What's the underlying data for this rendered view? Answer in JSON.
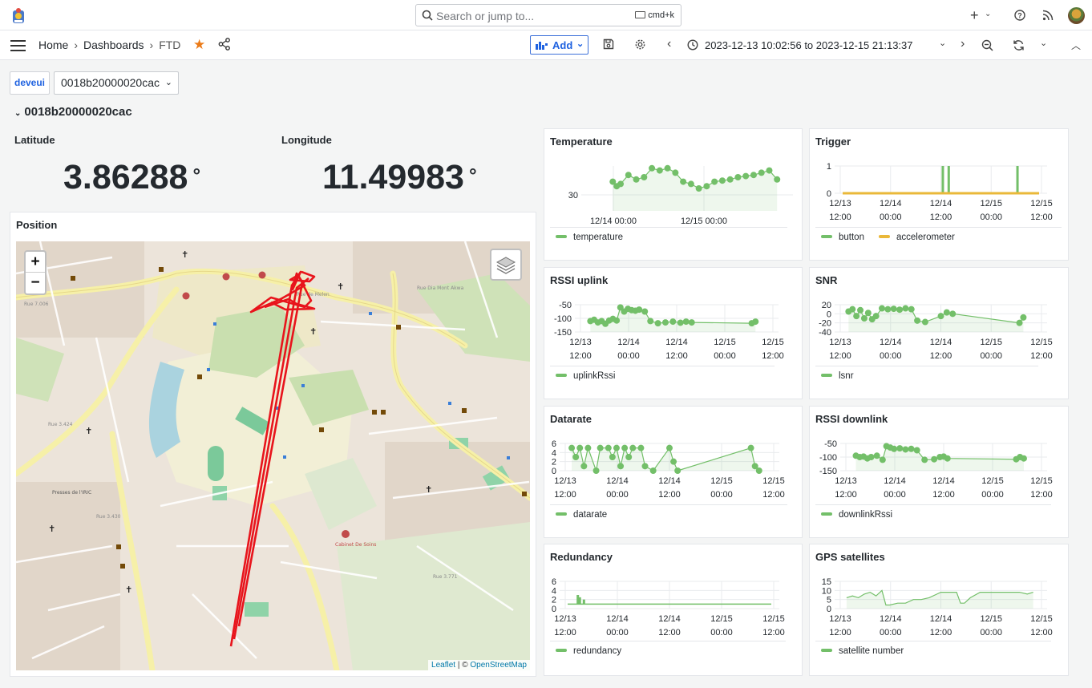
{
  "header": {
    "search_placeholder": "Search or jump to...",
    "search_shortcut": "cmd+k"
  },
  "nav": {
    "breadcrumb": [
      "Home",
      "Dashboards",
      "FTD"
    ],
    "add_label": "Add",
    "time_range": "2023-12-13 10:02:56 to 2023-12-15 21:13:37"
  },
  "variables": {
    "label": "deveui",
    "value": "0018b20000020cac"
  },
  "row": {
    "title": "0018b20000020cac"
  },
  "stats": [
    {
      "title": "Latitude",
      "value": "3.86288",
      "unit": "°"
    },
    {
      "title": "Longitude",
      "value": "11.49983",
      "unit": "°"
    }
  ],
  "map": {
    "title": "Position",
    "zoom_in": "+",
    "zoom_out": "−",
    "attribution_leaflet": "Leaflet",
    "attribution_sep": " | © ",
    "attribution_osm": "OpenStreetMap",
    "track_color": "#e8141c"
  },
  "colors": {
    "green": "#73bf69",
    "yellow": "#eab839",
    "accent": "#1f62e0",
    "star": "#eb7b18"
  },
  "chart_data": [
    {
      "id": "temperature",
      "title": "Temperature",
      "type": "line",
      "xticks": [
        "12/14 00:00",
        "12/15 00:00"
      ],
      "yticks": [
        "30"
      ],
      "ylim": [
        29,
        31
      ],
      "series": [
        {
          "name": "temperature",
          "color": "#73bf69",
          "x": [
            0.12,
            0.14,
            0.16,
            0.2,
            0.24,
            0.28,
            0.32,
            0.36,
            0.4,
            0.44,
            0.48,
            0.52,
            0.56,
            0.6,
            0.64,
            0.68,
            0.72,
            0.76,
            0.8,
            0.84,
            0.88,
            0.92,
            0.96
          ],
          "y": [
            30.3,
            30.1,
            30.2,
            30.6,
            30.4,
            30.5,
            30.9,
            30.8,
            30.9,
            30.7,
            30.3,
            30.2,
            30.0,
            30.1,
            30.3,
            30.35,
            30.4,
            30.5,
            30.55,
            30.6,
            30.7,
            30.8,
            30.4
          ]
        }
      ]
    },
    {
      "id": "trigger",
      "title": "Trigger",
      "type": "line",
      "xticks": [
        "12/13\n12:00",
        "12/14\n00:00",
        "12/14\n12:00",
        "12/15\n00:00",
        "12/15\n12:00"
      ],
      "yticks": [
        "1",
        "0"
      ],
      "ylim": [
        0,
        1
      ],
      "series": [
        {
          "name": "button",
          "color": "#73bf69",
          "spikes": [
            0.51,
            0.54,
            0.89
          ]
        },
        {
          "name": "accelerometer",
          "color": "#eab839",
          "y": [
            0
          ]
        }
      ]
    },
    {
      "id": "rssi-uplink",
      "title": "RSSI uplink",
      "type": "scatter",
      "xticks": [
        "12/13\n12:00",
        "12/14\n00:00",
        "12/14\n12:00",
        "12/15\n00:00",
        "12/15\n12:00"
      ],
      "yticks": [
        "-50",
        "-100",
        "-150"
      ],
      "ylim": [
        -150,
        -50
      ],
      "series": [
        {
          "name": "uplinkRssi",
          "color": "#73bf69",
          "x": [
            0.04,
            0.06,
            0.08,
            0.1,
            0.12,
            0.14,
            0.16,
            0.18,
            0.2,
            0.22,
            0.24,
            0.26,
            0.28,
            0.3,
            0.33,
            0.36,
            0.4,
            0.44,
            0.48,
            0.52,
            0.55,
            0.58,
            0.9,
            0.92
          ],
          "y": [
            -110,
            -105,
            -115,
            -110,
            -120,
            -108,
            -102,
            -108,
            -60,
            -75,
            -65,
            -70,
            -72,
            -68,
            -75,
            -110,
            -118,
            -115,
            -112,
            -116,
            -112,
            -115,
            -118,
            -112
          ]
        }
      ]
    },
    {
      "id": "snr",
      "title": "SNR",
      "type": "scatter",
      "xticks": [
        "12/13\n12:00",
        "12/14\n00:00",
        "12/14\n12:00",
        "12/15\n00:00",
        "12/15\n12:00"
      ],
      "yticks": [
        "20",
        "0",
        "-20",
        "-40"
      ],
      "ylim": [
        -40,
        20
      ],
      "series": [
        {
          "name": "lsnr",
          "color": "#73bf69",
          "x": [
            0.03,
            0.05,
            0.07,
            0.09,
            0.11,
            0.13,
            0.15,
            0.17,
            0.2,
            0.23,
            0.26,
            0.29,
            0.32,
            0.35,
            0.38,
            0.42,
            0.5,
            0.53,
            0.56,
            0.9,
            0.92
          ],
          "y": [
            5,
            10,
            -5,
            8,
            -10,
            2,
            -12,
            -5,
            12,
            10,
            11,
            9,
            12,
            10,
            -15,
            -18,
            -5,
            3,
            0,
            -20,
            -8
          ]
        }
      ]
    },
    {
      "id": "datarate",
      "title": "Datarate",
      "type": "scatter",
      "xticks": [
        "12/13\n12:00",
        "12/14\n00:00",
        "12/14\n12:00",
        "12/15\n00:00",
        "12/15\n12:00"
      ],
      "yticks": [
        "6",
        "4",
        "2",
        "0"
      ],
      "ylim": [
        0,
        6
      ],
      "series": [
        {
          "name": "datarate",
          "color": "#73bf69",
          "x": [
            0.02,
            0.04,
            0.06,
            0.08,
            0.1,
            0.14,
            0.16,
            0.2,
            0.22,
            0.24,
            0.26,
            0.28,
            0.3,
            0.32,
            0.36,
            0.38,
            0.42,
            0.5,
            0.52,
            0.54,
            0.9,
            0.92,
            0.94
          ],
          "y": [
            5,
            3,
            5,
            1,
            5,
            0,
            5,
            5,
            3,
            5,
            1,
            5,
            3,
            5,
            5,
            1,
            0,
            5,
            2,
            0,
            5,
            1,
            0
          ]
        }
      ]
    },
    {
      "id": "rssi-downlink",
      "title": "RSSI downlink",
      "type": "scatter",
      "xticks": [
        "12/13\n12:00",
        "12/14\n00:00",
        "12/14\n12:00",
        "12/15\n00:00",
        "12/15\n12:00"
      ],
      "yticks": [
        "-50",
        "-100",
        "-150"
      ],
      "ylim": [
        -150,
        -50
      ],
      "series": [
        {
          "name": "downlinkRssi",
          "color": "#73bf69",
          "x": [
            0.04,
            0.06,
            0.08,
            0.1,
            0.12,
            0.15,
            0.18,
            0.2,
            0.22,
            0.24,
            0.27,
            0.3,
            0.33,
            0.36,
            0.4,
            0.45,
            0.48,
            0.5,
            0.52,
            0.88,
            0.9,
            0.92
          ],
          "y": [
            -95,
            -100,
            -98,
            -105,
            -100,
            -95,
            -110,
            -60,
            -65,
            -70,
            -68,
            -72,
            -70,
            -75,
            -110,
            -108,
            -100,
            -98,
            -105,
            -108,
            -100,
            -105
          ]
        }
      ]
    },
    {
      "id": "redundancy",
      "title": "Redundancy",
      "type": "line",
      "xticks": [
        "12/13\n12:00",
        "12/14\n00:00",
        "12/14\n12:00",
        "12/15\n00:00",
        "12/15\n12:00"
      ],
      "yticks": [
        "6",
        "4",
        "2",
        "0"
      ],
      "ylim": [
        0,
        6
      ],
      "series": [
        {
          "name": "redundancy",
          "color": "#73bf69",
          "spikes": [
            0.05,
            0.06,
            0.08,
            0.46,
            0.48
          ],
          "spike_heights": [
            3,
            2.5,
            2,
            1,
            1
          ],
          "baseline": 1
        }
      ]
    },
    {
      "id": "gps-satellites",
      "title": "GPS satellites",
      "type": "line",
      "xticks": [
        "12/13\n12:00",
        "12/14\n00:00",
        "12/14\n12:00",
        "12/15\n00:00",
        "12/15\n12:00"
      ],
      "yticks": [
        "15",
        "10",
        "5",
        "0"
      ],
      "ylim": [
        0,
        15
      ],
      "series": [
        {
          "name": "satellite number",
          "color": "#73bf69",
          "x": [
            0.02,
            0.05,
            0.08,
            0.11,
            0.14,
            0.17,
            0.2,
            0.22,
            0.24,
            0.28,
            0.32,
            0.36,
            0.4,
            0.44,
            0.48,
            0.5,
            0.52,
            0.55,
            0.58,
            0.6,
            0.62,
            0.65,
            0.7,
            0.78,
            0.86,
            0.9,
            0.94,
            0.97
          ],
          "y": [
            6,
            7,
            6,
            8,
            9,
            7,
            10,
            2,
            2,
            3,
            3,
            5,
            5,
            6,
            8,
            9,
            9,
            9,
            9,
            3,
            3,
            6,
            9,
            9,
            9,
            9,
            8,
            9
          ]
        }
      ]
    }
  ]
}
